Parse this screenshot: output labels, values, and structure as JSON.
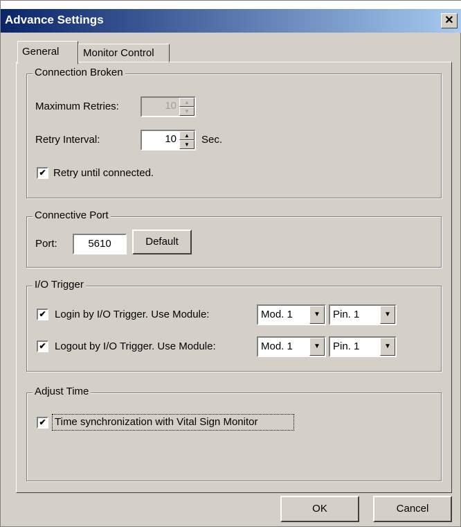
{
  "window": {
    "title": "Advance Settings",
    "close_glyph": "✕"
  },
  "tabs": [
    {
      "label": "General"
    },
    {
      "label": "Monitor Control"
    }
  ],
  "connection_broken": {
    "legend": "Connection Broken",
    "max_retries_label": "Maximum Retries:",
    "max_retries_value": "10",
    "retry_interval_label": "Retry Interval:",
    "retry_interval_value": "10",
    "retry_interval_unit": "Sec.",
    "retry_until_connected_label": "Retry until connected.",
    "retry_until_connected_checked": true
  },
  "connective_port": {
    "legend": "Connective Port",
    "port_label": "Port:",
    "port_value": "5610",
    "default_button": "Default"
  },
  "io_trigger": {
    "legend": "I/O Trigger",
    "login_label": "Login by I/O Trigger. Use Module:",
    "login_checked": true,
    "login_module": "Mod. 1",
    "login_pin": "Pin. 1",
    "logout_label": "Logout by I/O Trigger. Use Module:",
    "logout_checked": true,
    "logout_module": "Mod. 1",
    "logout_pin": "Pin. 1"
  },
  "adjust_time": {
    "legend": "Adjust Time",
    "sync_label": "Time synchronization with Vital Sign Monitor",
    "sync_checked": true
  },
  "footer": {
    "ok": "OK",
    "cancel": "Cancel"
  },
  "glyphs": {
    "check": "✔",
    "up": "▲",
    "down": "▼"
  }
}
